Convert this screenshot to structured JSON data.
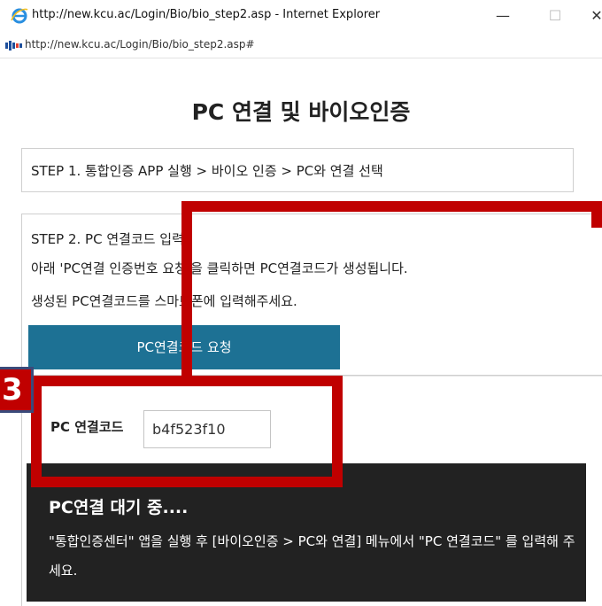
{
  "window": {
    "title": "http://new.kcu.ac/Login/Bio/bio_step2.asp - Internet Explorer",
    "minimize_glyph": "—",
    "maximize_glyph": "☐",
    "close_glyph": "✕"
  },
  "address": {
    "url": "http://new.kcu.ac/Login/Bio/bio_step2.asp#"
  },
  "page": {
    "title": "PC 연결 및 바이오인증"
  },
  "step1": {
    "text": "STEP 1. 통합인증 APP 실행 > 바이오 인증 > PC와 연결 선택"
  },
  "step2": {
    "heading": "STEP 2. PC 연결코드 입력",
    "desc1": "아래 'PC연결 인증번호 요청'을 클릭하면 PC연결코드가 생성됩니다.",
    "desc2": "생성된 PC연결코드를 스마트폰에 입력해주세요.",
    "button_label": "PC연결코드 요청"
  },
  "code": {
    "bullet": "·",
    "label": "PC 연결코드",
    "value": "b4f523f10"
  },
  "wait": {
    "title": "PC연결 대기 중....",
    "desc": "\"통합인증센터\" 앱을 실행 후 [바이오인증 > PC와 연결] 메뉴에서 \"PC 연결코드\" 를 입력해 주세요."
  },
  "annotation": {
    "step_number": "3",
    "color": "#c00000"
  },
  "colors": {
    "button": "#1d7194",
    "panel": "#222222"
  }
}
